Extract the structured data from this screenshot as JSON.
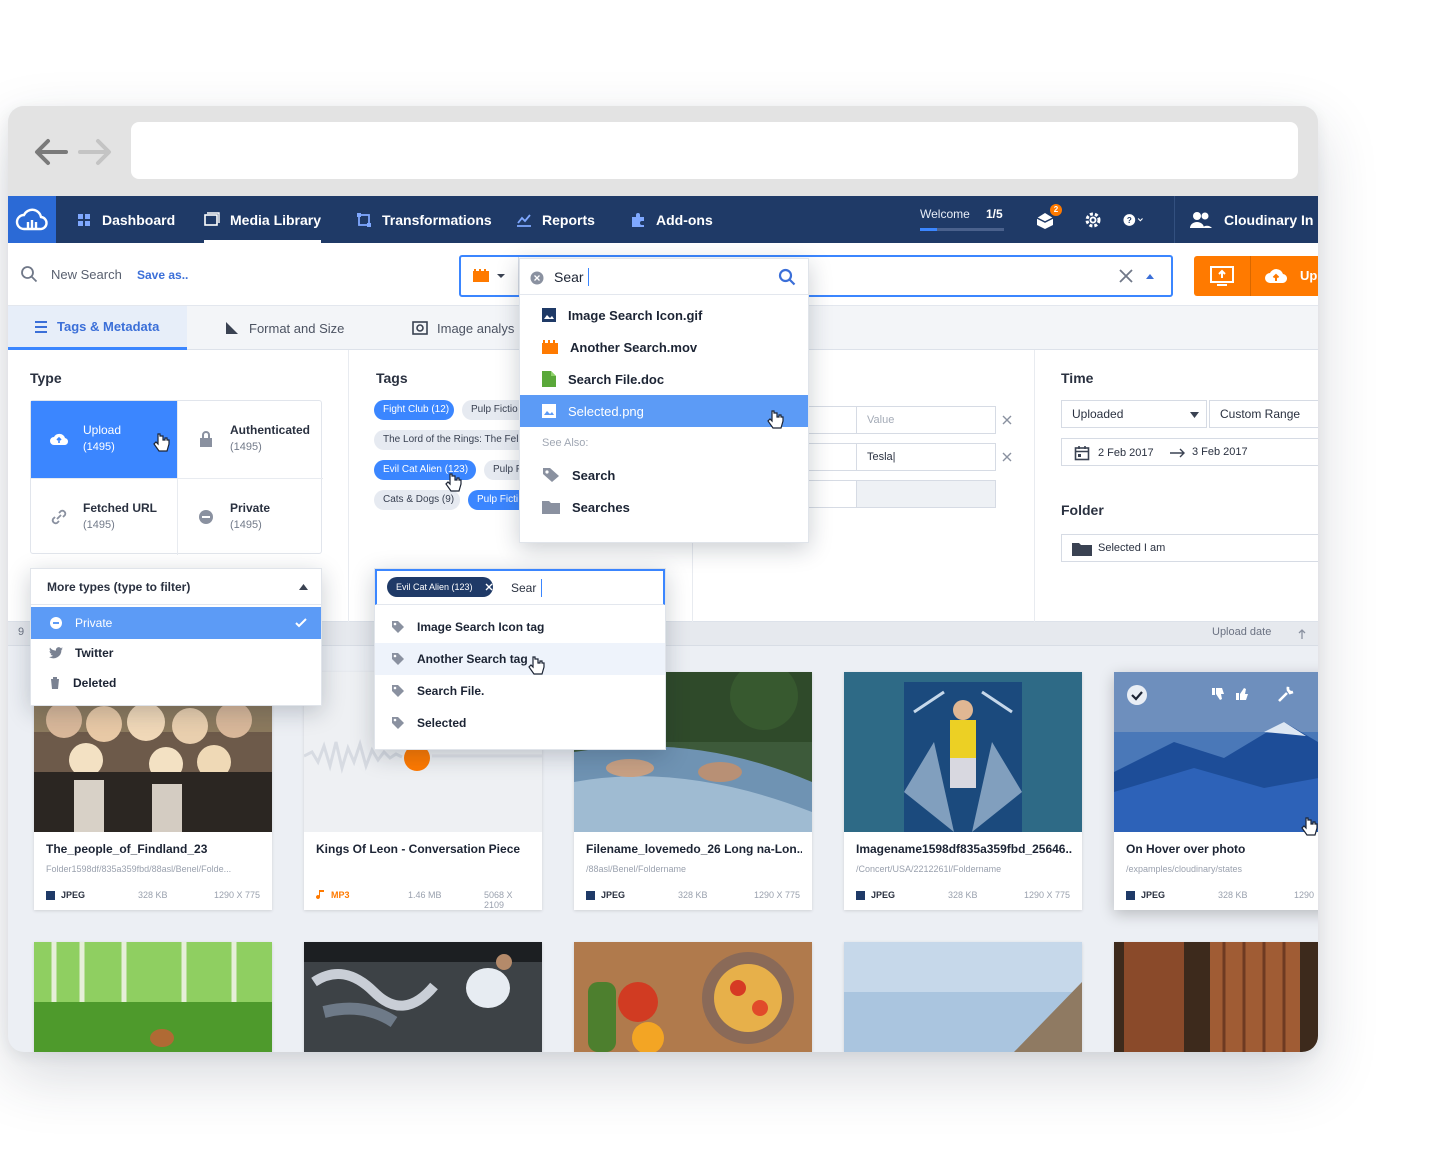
{
  "colors": {
    "nav_bg": "#1f3a67",
    "accent": "#3b86ff",
    "upload": "#ff7a00"
  },
  "nav": {
    "logo_icon": "cloud-logo-icon",
    "items": [
      {
        "label": "Dashboard",
        "icon": "dashboard-icon"
      },
      {
        "label": "Media Library",
        "icon": "media-library-icon"
      },
      {
        "label": "Transformations",
        "icon": "transformations-icon"
      },
      {
        "label": "Reports",
        "icon": "reports-icon"
      },
      {
        "label": "Add-ons",
        "icon": "puzzle-icon"
      }
    ],
    "welcome_label": "Welcome",
    "welcome_progress": "1/5",
    "welcome_fraction": 0.2,
    "notification_count": "2",
    "account_label": "Cloudinary In"
  },
  "search": {
    "new_search": "New Search",
    "save_as": "Save as..",
    "query": "Sear",
    "upload_label": "Up"
  },
  "tabs": [
    {
      "label": "Tags & Metadata"
    },
    {
      "label": "Format and Size"
    },
    {
      "label": "Image analys"
    }
  ],
  "filters": {
    "type_title": "Type",
    "types": [
      {
        "label": "Upload",
        "count": "(1495)"
      },
      {
        "label": "Authenticated",
        "count": "(1495)"
      },
      {
        "label": "Fetched URL",
        "count": "(1495)"
      },
      {
        "label": "Private",
        "count": "(1495)"
      }
    ],
    "more_types": "More types (type to filter)",
    "more_types_options": [
      "Private",
      "Twitter",
      "Deleted"
    ],
    "tags_title": "Tags",
    "tags": [
      "Fight Club (12)",
      "Pulp Fictio",
      "The Lord of the Rings: The Fel",
      "Evil Cat Alien (123)",
      "Pulp F",
      "Cats & Dogs (9)",
      "Pulp Ficti"
    ],
    "tag_input_chip": "Evil Cat Alien (123)",
    "tag_input_query": "Sear",
    "tag_suggestions": [
      "Image Search Icon tag",
      "Another Search tag",
      "Search File.",
      "Selected"
    ],
    "metadata": {
      "value_placeholder": "Value",
      "value_filled": "Tesla|"
    },
    "time_title": "Time",
    "time_uploaded": "Uploaded",
    "time_range": "Custom Range",
    "date_from": "2 Feb 2017",
    "date_to": "3 Feb 2017",
    "folder_title": "Folder",
    "folder_value": "Selected I am"
  },
  "search_dropdown": {
    "items": [
      {
        "label": "Image Search Icon.gif",
        "icon": "image-file-icon"
      },
      {
        "label": "Another Search.mov",
        "icon": "video-file-icon"
      },
      {
        "label": "Search File.doc",
        "icon": "doc-file-icon"
      },
      {
        "label": "Selected.png",
        "icon": "image-file-icon"
      }
    ],
    "see_also_label": "See Also:",
    "see_also": [
      {
        "label": "Search",
        "icon": "tag-icon"
      },
      {
        "label": "Searches",
        "icon": "folder-icon"
      }
    ]
  },
  "results": {
    "count_prefix": "9",
    "sort_label": "Upload date",
    "cards": [
      {
        "name": "The_people_of_Findland_23",
        "path": "Folder1598df/835a359fbd/88asl/Benel/Folde...",
        "format": "JPEG",
        "size": "328 KB",
        "dims": "1290 X 775"
      },
      {
        "name": "Kings Of Leon - Conversation Piece",
        "path": "",
        "format": "MP3",
        "size": "1.46 MB",
        "dims": "5068 X 2109"
      },
      {
        "name": "Filename_lovemedo_26 Long na-Lon...",
        "path": "/88asl/Benel/Foldername",
        "format": "JPEG",
        "size": "328 KB",
        "dims": "1290 X 775"
      },
      {
        "name": "Imagename1598df835a359fbd_25646...",
        "path": "/Concert/USA/2212261l/Foldername",
        "format": "JPEG",
        "size": "328 KB",
        "dims": "1290 X 775"
      },
      {
        "name": "On Hover over photo",
        "path": "/expamples/cloudinary/states",
        "format": "JPEG",
        "size": "328 KB",
        "dims": "1290"
      }
    ]
  }
}
